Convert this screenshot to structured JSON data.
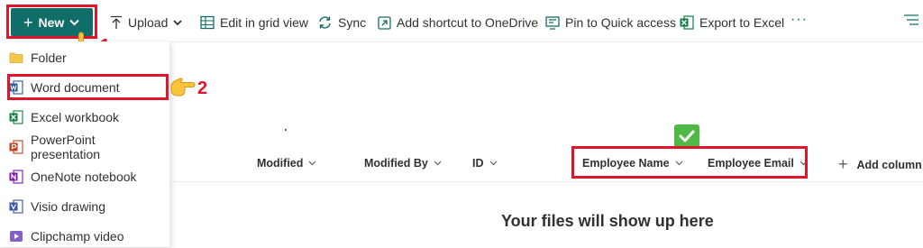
{
  "toolbar": {
    "new_label": "New",
    "upload_label": "Upload",
    "edit_grid_label": "Edit in grid view",
    "sync_label": "Sync",
    "add_shortcut_label": "Add shortcut to OneDrive",
    "pin_label": "Pin to Quick access",
    "export_label": "Export to Excel",
    "more_label": "···"
  },
  "new_menu": {
    "items": [
      {
        "label": "Folder",
        "icon": "folder-icon"
      },
      {
        "label": "Word document",
        "icon": "word-icon"
      },
      {
        "label": "Excel workbook",
        "icon": "excel-icon"
      },
      {
        "label": "PowerPoint presentation",
        "icon": "powerpoint-icon"
      },
      {
        "label": "OneNote notebook",
        "icon": "onenote-icon"
      },
      {
        "label": "Visio drawing",
        "icon": "visio-icon"
      },
      {
        "label": "Clipchamp video",
        "icon": "clipchamp-icon"
      }
    ]
  },
  "annotations": {
    "step1": "1",
    "step2": "2",
    "highlight_color": "#e0142b"
  },
  "columns": {
    "modified": "Modified",
    "modified_by": "Modified By",
    "id": "ID",
    "employee_name": "Employee Name",
    "employee_email": "Employee Email",
    "add_column": "Add column"
  },
  "empty_state": {
    "title": "Your files will show up here"
  },
  "colors": {
    "accent": "#116d68",
    "check": "#4fb948"
  }
}
